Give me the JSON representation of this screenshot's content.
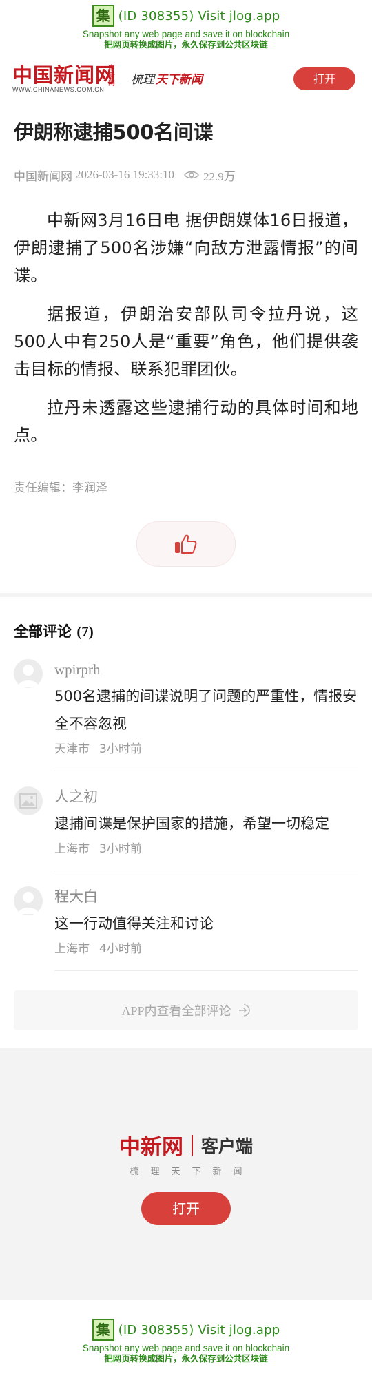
{
  "jlog": {
    "icon_char": "集",
    "main": "(ID 308355) Visit jlog.app",
    "sub_en": "Snapshot any web page and save it on blockchain",
    "sub_cn": "把网页转换成图片，永久保存到公共区块链"
  },
  "header": {
    "logo_cn": "中国新闻网",
    "logo_side": "中新网",
    "logo_en": "WWW.CHINANEWS.COM.CN",
    "slogan_1": "梳理",
    "slogan_2": "天下新闻",
    "open_label": "打开"
  },
  "article": {
    "title": "伊朗称逮捕500名间谍",
    "source": "中国新闻网",
    "datetime": "2026-03-16 19:33:10",
    "views": "22.9万",
    "paragraphs": [
      "中新网3月16日电 据伊朗媒体16日报道，伊朗逮捕了500名涉嫌“向敌方泄露情报”的间谍。",
      "据报道，伊朗治安部队司令拉丹说，这500人中有250人是“重要”角色，他们提供袭击目标的情报、联系犯罪团伙。",
      "拉丹未透露这些逮捕行动的具体时间和地点。"
    ],
    "editor": "责任编辑：李润泽"
  },
  "comments": {
    "title": "全部评论",
    "count": "(7)",
    "items": [
      {
        "user": "wpirprh",
        "text": "500名逮捕的间谍说明了问题的严重性，情报安全不容忽视",
        "location": "天津市",
        "time": "3小时前",
        "avatar": "person-avatar"
      },
      {
        "user": "人之初",
        "text": "逮捕间谍是保护国家的措施，希望一切稳定",
        "location": "上海市",
        "time": "3小时前",
        "avatar": "image-avatar"
      },
      {
        "user": "程大白",
        "text": "这一行动值得关注和讨论",
        "location": "上海市",
        "time": "4小时前",
        "avatar": "person-avatar"
      }
    ],
    "view_all": "APP内查看全部评论"
  },
  "promo": {
    "logo_cn": "中新网",
    "client": "客户端",
    "sub": "梳理天下新闻",
    "open_label": "打开"
  },
  "colors": {
    "brand_red": "#c4191f",
    "button_red": "#d8413b",
    "jlog_green": "#2a8a16"
  }
}
